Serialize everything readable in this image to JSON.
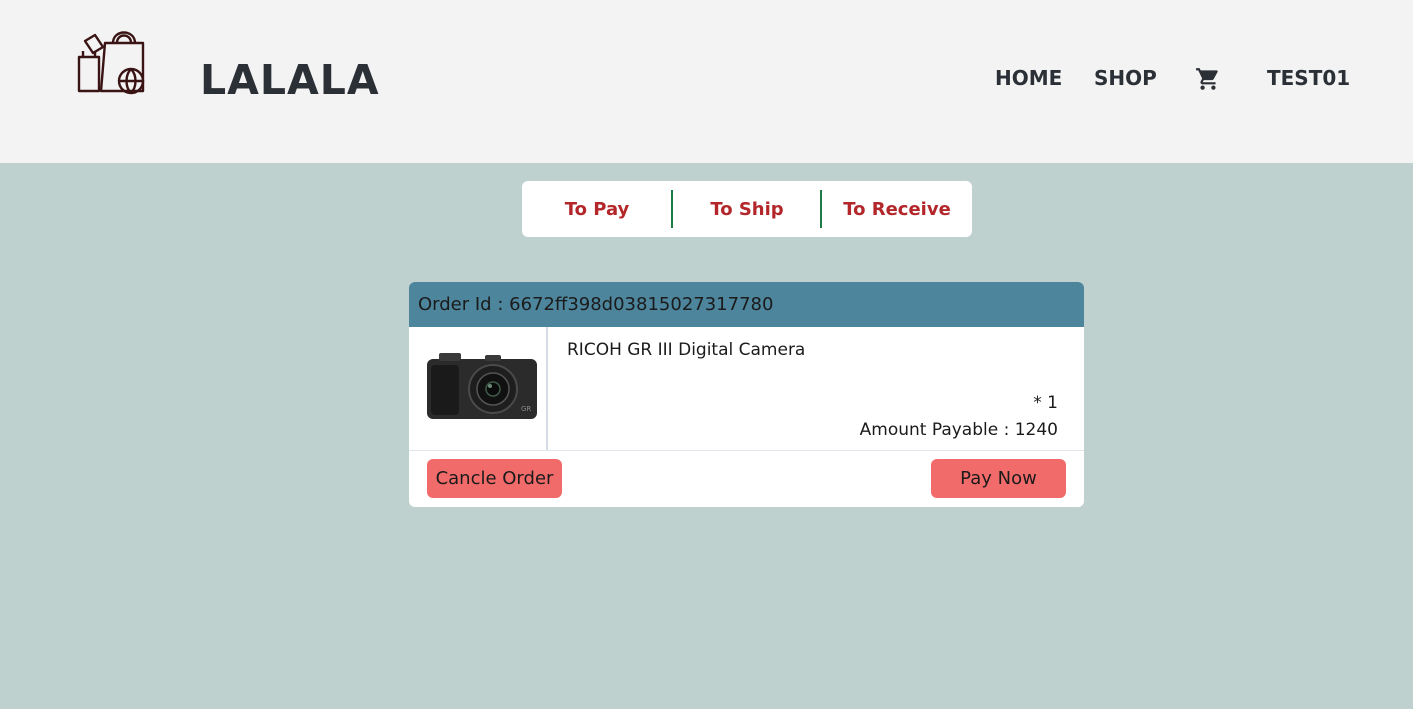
{
  "header": {
    "brand": "LALALA",
    "nav": {
      "home": "HOME",
      "shop": "SHOP",
      "user": "TEST01"
    }
  },
  "tabs": [
    "To Pay",
    "To Ship",
    "To Receive"
  ],
  "order": {
    "id_label": "Order Id : 6672ff398d03815027317780",
    "product_name": "RICOH GR III Digital Camera",
    "quantity": "* 1",
    "amount": "Amount Payable : 1240",
    "cancel_label": "Cancle Order",
    "pay_label": "Pay Now"
  }
}
